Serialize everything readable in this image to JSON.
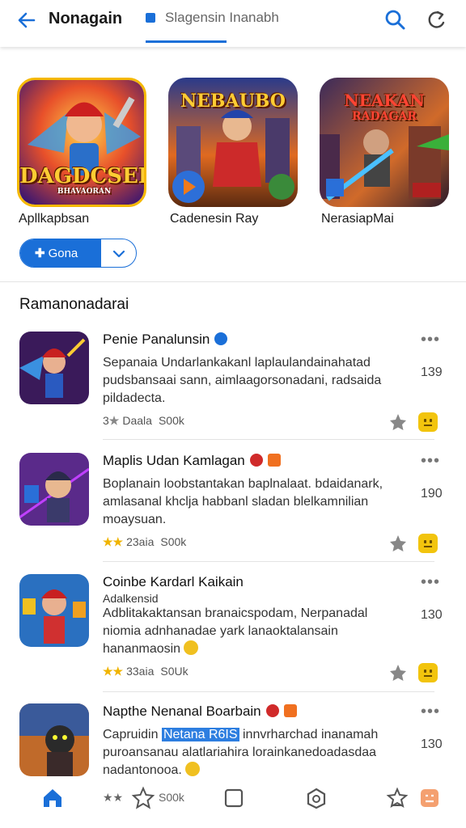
{
  "header": {
    "app_title": "Nonagain",
    "tab_label": "Slagensin Inanabh",
    "accent": "#1a6fd8"
  },
  "featured": [
    {
      "name": "Apllkapbsan",
      "art_title": "DAGDCSER",
      "art_subtitle": "BHAVAORAN",
      "icon": "hero-game-art"
    },
    {
      "name": "Cadenesin Ray",
      "art_title": "NEBAUBO",
      "icon": "warrior-game-art"
    },
    {
      "name": "NerasiapMai",
      "art_title": "NEAKAN",
      "art_subtitle": "RADAGAR",
      "icon": "city-battle-art"
    }
  ],
  "get_button": {
    "label": "Gona",
    "prefix": "✚"
  },
  "section_title": "Ramanonadarai",
  "items": [
    {
      "title": "Penie Panalunsin",
      "desc": "Sepanaia Undarlankakanl laplaulandainahatad pudsbansaai sann, aimlaagorsonadani, radsaida pildadecta.",
      "count": "139",
      "rating": "Daala",
      "size": "S00k",
      "stars": "★",
      "stars_prefix": "3"
    },
    {
      "title": "Maplis Udan Kamlagan",
      "desc": "Boplanain loobstantakan baplnalaat. bdaidanark, amlasanal khclja habbanl sladan blelkamnilian moaysuan.",
      "count": "190",
      "rating": "23aia",
      "size": "S00k",
      "stars": "★★"
    },
    {
      "title": "Coinbe Kardarl Kaikain",
      "subtitle": "Adalkensid",
      "desc": "Adblitakaktansan branaicspodam, Nerpanadal niomia adnhanadae yark lanaoktalansain hananmaosin",
      "count": "130",
      "rating": "33aia",
      "size": "S0Uk",
      "stars": "★★"
    },
    {
      "title": "Napthe Nenanal Boarbain",
      "desc_pre": "Capruidin",
      "desc_hl": "Netana R6IS",
      "desc_post": "innvrharchad inanamah puroansanau alatlariahira lorainkanedoadasdaa nadantonooa.",
      "count": "130",
      "rating": "",
      "size": "S00k",
      "stars": "★★"
    }
  ],
  "bottom_nav": [
    "home-icon",
    "star-icon",
    "library-icon",
    "updates-icon",
    "games-icon",
    "profile-icon"
  ]
}
